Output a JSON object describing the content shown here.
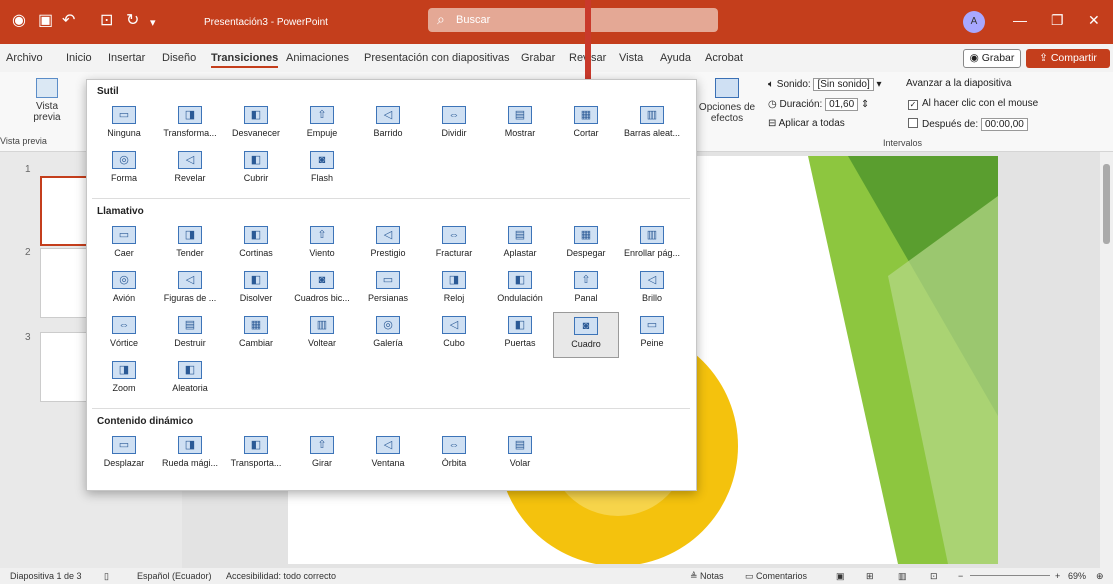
{
  "app": {
    "doc_title": "Presentación3 - PowerPoint",
    "search_placeholder": "Buscar",
    "avatar_initial": "A"
  },
  "tabs": [
    "Archivo",
    "Inicio",
    "Insertar",
    "Diseño",
    "Transiciones",
    "Animaciones",
    "Presentación con diapositivas",
    "Grabar",
    "Revisar",
    "Vista",
    "Ayuda",
    "Acrobat"
  ],
  "active_tab": "Transiciones",
  "header_buttons": {
    "grabar": "Grabar",
    "compartir": "Compartir"
  },
  "ribbon": {
    "vista_previa": "Vista previa",
    "vista_previa_group": "Vista previa",
    "opciones_efectos": "Opciones de efectos",
    "sonido_label": "Sonido:",
    "sonido_value": "[Sin sonido]",
    "duracion_label": "Duración:",
    "duracion_value": "01,60",
    "aplicar_todas": "Aplicar a todas",
    "avanzar": "Avanzar a la diapositiva",
    "al_hacer_clic": "Al hacer clic con el mouse",
    "despues_de": "Después de:",
    "despues_value": "00:00,00",
    "intervalos": "Intervalos"
  },
  "gallery": {
    "sections": [
      "Sutil",
      "Llamativo",
      "Contenido dinámico"
    ],
    "sutil": [
      "Ninguna",
      "Transforma...",
      "Desvanecer",
      "Empuje",
      "Barrido",
      "Dividir",
      "Mostrar",
      "Cortar",
      "Barras aleat...",
      "Forma",
      "Revelar",
      "Cubrir",
      "Flash"
    ],
    "llamativo": [
      "Caer",
      "Tender",
      "Cortinas",
      "Viento",
      "Prestigio",
      "Fracturar",
      "Aplastar",
      "Despegar",
      "Enrollar pág...",
      "Avión",
      "Figuras de ...",
      "Disolver",
      "Cuadros bic...",
      "Persianas",
      "Reloj",
      "Ondulación",
      "Panal",
      "Brillo",
      "Vórtice",
      "Destruir",
      "Cambiar",
      "Voltear",
      "Galería",
      "Cubo",
      "Puertas",
      "Cuadro",
      "Peine",
      "Zoom",
      "Aleatoria"
    ],
    "dinamico": [
      "Desplazar",
      "Rueda mági...",
      "Transporta...",
      "Girar",
      "Ventana",
      "Órbita",
      "Volar"
    ],
    "selected": "Cuadro"
  },
  "thumbnails": [
    "1",
    "2",
    "3"
  ],
  "status": {
    "slide": "Diapositiva 1 de 3",
    "language": "Español (Ecuador)",
    "accessibility": "Accesibilidad: todo correcto",
    "notas": "Notas",
    "comentarios": "Comentarios",
    "zoom": "69%"
  }
}
